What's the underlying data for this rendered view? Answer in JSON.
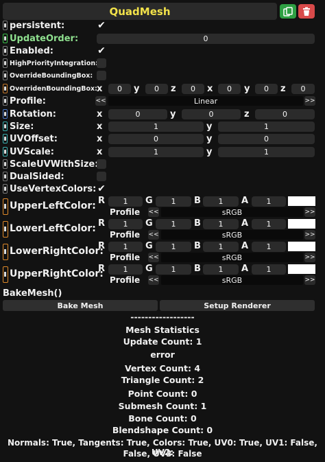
{
  "header": {
    "title": "QuadMesh"
  },
  "fields": {
    "persistent": {
      "label": "persistent:",
      "checked": "✔"
    },
    "update_order": {
      "label": "UpdateOrder:",
      "value": "0"
    },
    "enabled": {
      "label": "Enabled:",
      "checked": "✔"
    },
    "high_priority": {
      "label": "HighPriorityIntegration:"
    },
    "override_bbox": {
      "label": "OverrideBoundingBox:"
    },
    "overriden_bbox": {
      "label": "OverridenBoundingBox:",
      "axes": [
        "x",
        "y",
        "z",
        "x",
        "y",
        "z"
      ],
      "values": [
        "0",
        "0",
        "0",
        "0",
        "0",
        "0"
      ]
    },
    "profile": {
      "label": "Profile:",
      "value": "Linear",
      "prev": "<<",
      "next": ">>"
    },
    "rotation": {
      "label": "Rotation:",
      "axes": [
        "x",
        "y",
        "z"
      ],
      "values": [
        "0",
        "0",
        "0"
      ]
    },
    "size": {
      "label": "Size:",
      "axes": [
        "x",
        "y"
      ],
      "values": [
        "1",
        "1"
      ]
    },
    "uv_offset": {
      "label": "UVOffset:",
      "axes": [
        "x",
        "y"
      ],
      "values": [
        "0",
        "0"
      ]
    },
    "uv_scale": {
      "label": "UVScale:",
      "axes": [
        "x",
        "y"
      ],
      "values": [
        "1",
        "1"
      ]
    },
    "scale_uv_with_size": {
      "label": "ScaleUVWithSize:"
    },
    "dual_sided": {
      "label": "DualSided:"
    },
    "use_vertex_colors": {
      "label": "UseVertexColors:",
      "checked": "✔"
    }
  },
  "colors": [
    {
      "label": "UpperLeftColor:",
      "channels": [
        "R",
        "G",
        "B",
        "A"
      ],
      "values": [
        "1",
        "1",
        "1",
        "1"
      ],
      "profile_label": "Profile",
      "profile": "sRGB",
      "swatch": "#ffffff"
    },
    {
      "label": "LowerLeftColor:",
      "channels": [
        "R",
        "G",
        "B",
        "A"
      ],
      "values": [
        "1",
        "1",
        "1",
        "1"
      ],
      "profile_label": "Profile",
      "profile": "sRGB",
      "swatch": "#ffffff"
    },
    {
      "label": "LowerRightColor:",
      "channels": [
        "R",
        "G",
        "B",
        "A"
      ],
      "values": [
        "1",
        "1",
        "1",
        "1"
      ],
      "profile_label": "Profile",
      "profile": "sRGB",
      "swatch": "#ffffff"
    },
    {
      "label": "UpperRightColor:",
      "channels": [
        "R",
        "G",
        "B",
        "A"
      ],
      "values": [
        "1",
        "1",
        "1",
        "1"
      ],
      "profile_label": "Profile",
      "profile": "sRGB",
      "swatch": "#ffffff"
    }
  ],
  "method": {
    "label": "BakeMesh()"
  },
  "buttons": {
    "bake": "Bake Mesh",
    "setup": "Setup Renderer"
  },
  "stats": {
    "divider": "------------------",
    "title": "Mesh Statistics",
    "update_count": "Update Count: 1",
    "error": "error",
    "vertex_count": "Vertex Count: 4",
    "triangle_count": "Triangle Count: 2",
    "point_count": "Point Count: 0",
    "submesh_count": "Submesh Count: 1",
    "bone_count": "Bone Count: 0",
    "blendshape_count": "Blendshape Count: 0",
    "flags_line1": "Normals: True, Tangents: True, Colors: True, UV0: True, UV1: False, UV2:",
    "flags_line2": "False, UV3: False"
  },
  "palette": {
    "title": "#f2e24a",
    "duplicate": "#2ea043",
    "delete": "#d84a4a",
    "color_icon": "#e08a2a"
  }
}
